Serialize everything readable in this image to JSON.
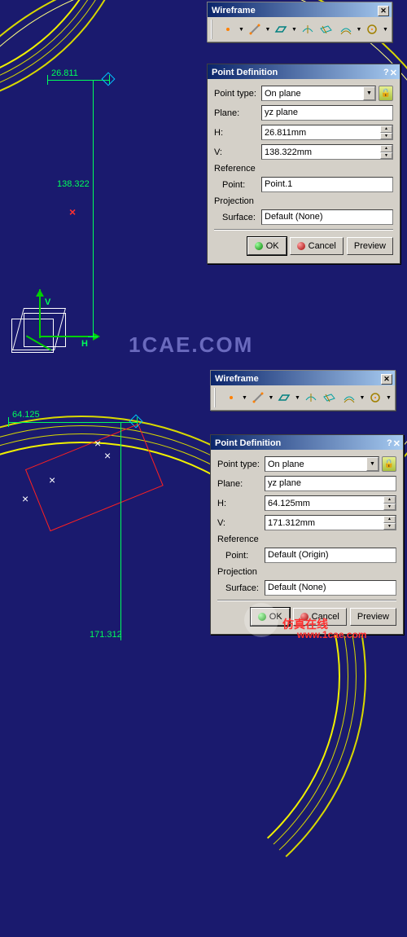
{
  "toolbar1": {
    "title": "Wireframe"
  },
  "toolbar2": {
    "title": "Wireframe"
  },
  "icons": [
    "point",
    "line",
    "plane",
    "proj",
    "intersect",
    "offset",
    "circle",
    "helix"
  ],
  "dialog1": {
    "title": "Point Definition",
    "point_type_label": "Point type:",
    "point_type_value": "On plane",
    "plane_label": "Plane:",
    "plane_value": "yz plane",
    "h_label": "H:",
    "h_value": "26.811mm",
    "v_label": "V:",
    "v_value": "138.322mm",
    "reference_label": "Reference",
    "point_label": "Point:",
    "point_value": "Point.1",
    "projection_label": "Projection",
    "surface_label": "Surface:",
    "surface_value": "Default (None)",
    "ok": "OK",
    "cancel": "Cancel",
    "preview": "Preview"
  },
  "dialog2": {
    "title": "Point Definition",
    "point_type_label": "Point type:",
    "point_type_value": "On plane",
    "plane_label": "Plane:",
    "plane_value": "yz plane",
    "h_label": "H:",
    "h_value": "64.125mm",
    "v_label": "V:",
    "v_value": "171.312mm",
    "reference_label": "Reference",
    "point_label": "Point:",
    "point_value": "Default (Origin)",
    "projection_label": "Projection",
    "surface_label": "Surface:",
    "surface_value": "Default (None)",
    "ok": "OK",
    "cancel": "Cancel",
    "preview": "Preview"
  },
  "dims": {
    "h1": "26.811",
    "v1": "138.322",
    "h2": "64.125",
    "v2": "171.312",
    "hlabel": "H",
    "vlabel": "V"
  },
  "watermark": {
    "center": "1CAE.COM",
    "bottom1": "仿真在线",
    "bottom2": "www.1cae.com"
  }
}
